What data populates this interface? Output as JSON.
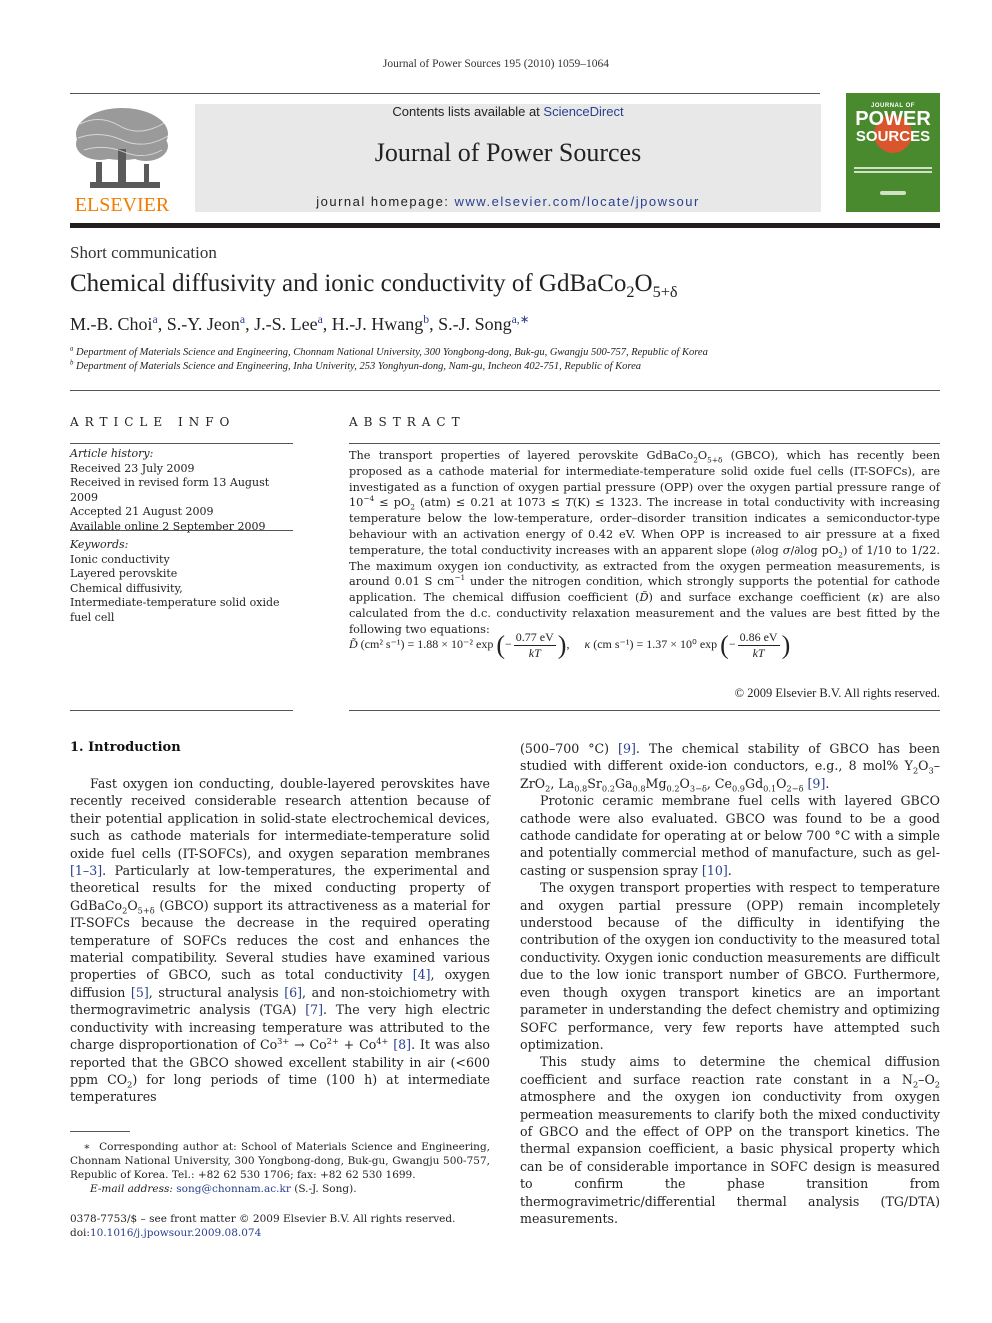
{
  "running_head": "Journal of Power Sources 195 (2010) 1059–1064",
  "header": {
    "contents_prefix": "Contents lists available at ",
    "contents_link": "ScienceDirect",
    "journal_title": "Journal of Power Sources",
    "homepage_prefix": "journal homepage: ",
    "homepage_link": "www.elsevier.com/locate/jpowsour",
    "publisher_logo": "ELSEVIER",
    "cover_title_top": "JOURNAL OF",
    "cover_title_main": "POWER",
    "cover_title_sub": "SOURCES",
    "colors": {
      "link": "#2a3f8f",
      "elsevier_orange": "#f07c00",
      "cover_green": "#4a8a2e",
      "cover_sun": "#d9552b"
    }
  },
  "article": {
    "type": "Short communication",
    "title_main": "Chemical diffusivity and ionic conductivity of GdBaCo",
    "title_sub2": "2",
    "title_o": "O",
    "title_sub_delta": "5+δ",
    "authors": [
      {
        "name": "M.-B. Choi",
        "affil": "a"
      },
      {
        "name": "S.-Y. Jeon",
        "affil": "a"
      },
      {
        "name": "J.-S. Lee",
        "affil": "a"
      },
      {
        "name": "H.-J. Hwang",
        "affil": "b"
      },
      {
        "name": "S.-J. Song",
        "affil": "a,∗"
      }
    ],
    "affiliations": [
      {
        "mark": "a",
        "text": "Department of Materials Science and Engineering, Chonnam National University, 300 Yongbong-dong, Buk-gu, Gwangju 500-757, Republic of Korea"
      },
      {
        "mark": "b",
        "text": "Department of Materials Science and Engineering, Inha Univerity, 253 Yonghyun-dong, Nam-gu, Incheon 402-751, Republic of Korea"
      }
    ]
  },
  "article_info": {
    "label": "ARTICLE INFO",
    "history_label": "Article history:",
    "history": [
      "Received 23 July 2009",
      "Received in revised form 13 August 2009",
      "Accepted 21 August 2009",
      "Available online 2 September 2009"
    ],
    "keywords_label": "Keywords:",
    "keywords": [
      "Ionic conductivity",
      "Layered perovskite",
      "Chemical diffusivity,",
      "Intermediate-temperature solid oxide fuel cell"
    ]
  },
  "abstract": {
    "label": "ABSTRACT",
    "segments": [
      {
        "t": "The transport properties of layered perovskite GdBaCo"
      },
      {
        "sub": "2"
      },
      {
        "t": "O"
      },
      {
        "sub": "5+δ"
      },
      {
        "t": " (GBCO), which has recently been proposed as a cathode material for intermediate-temperature solid oxide fuel cells (IT-SOFCs), are investigated as a function of oxygen partial pressure (OPP) over the oxygen partial pressure range of 10"
      },
      {
        "sup": "−4"
      },
      {
        "t": " ≤ pO"
      },
      {
        "sub": "2"
      },
      {
        "t": " (atm) ≤ 0.21 at 1073 ≤ "
      },
      {
        "i": "T"
      },
      {
        "t": "(K) ≤ 1323. The increase in total conductivity with increasing temperature below the low-temperature, order–disorder transition indicates a semiconductor-type behaviour with an activation energy of 0.42 eV. When OPP is increased to air pressure at a fixed temperature, the total conductivity increases with an apparent slope (∂log "
      },
      {
        "i": "σ"
      },
      {
        "t": "/∂log pO"
      },
      {
        "sub": "2"
      },
      {
        "t": ") of 1/10 to 1/22. The maximum oxygen ion conductivity, as extracted from the oxygen permeation measurements, is around 0.01 S cm"
      },
      {
        "sup": "−1"
      },
      {
        "t": " under the nitrogen condition, which strongly supports the potential for cathode application. The chemical diffusion coefficient ("
      },
      {
        "i": "D̃"
      },
      {
        "t": ") and surface exchange coefficient ("
      },
      {
        "i": "κ"
      },
      {
        "t": ") are also calculated from the d.c. conductivity relaxation measurement and the values are best fitted by the following two equations:"
      }
    ],
    "equation": {
      "d_symbol": "D̃",
      "d_units": "(cm² s⁻¹) = 1.88 × 10⁻² exp",
      "d_num": "0.77 eV",
      "d_den": "kT",
      "k_symbol": "κ",
      "k_units": "(cm s⁻¹) = 1.37 × 10⁰ exp",
      "k_num": "0.86 eV",
      "k_den": "kT"
    },
    "copyright": "© 2009 Elsevier B.V. All rights reserved."
  },
  "introduction": {
    "heading": "1.  Introduction",
    "left_column": [
      {
        "indent": true,
        "segments": [
          {
            "t": "Fast oxygen ion conducting, double-layered perovskites have recently received considerable research attention because of their potential application in solid-state electrochemical devices, such as cathode materials for intermediate-temperature solid oxide fuel cells (IT-SOFCs), and oxygen separation membranes "
          },
          {
            "ref": "[1–3]"
          },
          {
            "t": ". Particularly at low-temperatures, the experimental and theoretical results for the mixed conducting property of GdBaCo"
          },
          {
            "sub": "2"
          },
          {
            "t": "O"
          },
          {
            "sub": "5+δ"
          },
          {
            "t": " (GBCO) support its attractiveness as a material for IT-SOFCs because the decrease in the required operating temperature of SOFCs reduces the cost and enhances the material compatibility. Several studies have examined various properties of GBCO, such as total conductivity "
          },
          {
            "ref": "[4]"
          },
          {
            "t": ", oxygen diffusion "
          },
          {
            "ref": "[5]"
          },
          {
            "t": ", structural analysis "
          },
          {
            "ref": "[6]"
          },
          {
            "t": ", and non-stoichiometry with thermogravimetric analysis (TGA) "
          },
          {
            "ref": "[7]"
          },
          {
            "t": ". The very high electric conductivity with increasing temperature was attributed to the charge disproportionation of Co"
          },
          {
            "sup": "3+"
          },
          {
            "t": " → Co"
          },
          {
            "sup": "2+"
          },
          {
            "t": " + Co"
          },
          {
            "sup": "4+"
          },
          {
            "t": " "
          },
          {
            "ref": "[8]"
          },
          {
            "t": ". It was also reported that the GBCO showed excellent stability in air (<600 ppm CO"
          },
          {
            "sub": "2"
          },
          {
            "t": ") for long periods of time (100 h) at intermediate temperatures"
          }
        ]
      }
    ],
    "right_column": [
      {
        "indent": false,
        "segments": [
          {
            "t": "(500–700 °C) "
          },
          {
            "ref": "[9]"
          },
          {
            "t": ". The chemical stability of GBCO has been studied with different oxide-ion conductors, e.g., 8 mol% Y"
          },
          {
            "sub": "2"
          },
          {
            "t": "O"
          },
          {
            "sub": "3"
          },
          {
            "t": "–ZrO"
          },
          {
            "sub": "2"
          },
          {
            "t": ", La"
          },
          {
            "sub": "0.8"
          },
          {
            "t": "Sr"
          },
          {
            "sub": "0.2"
          },
          {
            "t": "Ga"
          },
          {
            "sub": "0.8"
          },
          {
            "t": "Mg"
          },
          {
            "sub": "0.2"
          },
          {
            "t": "O"
          },
          {
            "sub": "3−δ"
          },
          {
            "t": ", Ce"
          },
          {
            "sub": "0.9"
          },
          {
            "t": "Gd"
          },
          {
            "sub": "0.1"
          },
          {
            "t": "O"
          },
          {
            "sub": "2−δ"
          },
          {
            "t": " "
          },
          {
            "ref": "[9]"
          },
          {
            "t": "."
          }
        ]
      },
      {
        "indent": true,
        "segments": [
          {
            "t": "Protonic ceramic membrane fuel cells with layered GBCO cathode were also evaluated. GBCO was found to be a good cathode candidate for operating at or below 700 °C with a simple and potentially commercial method of manufacture, such as gel-casting or suspension spray "
          },
          {
            "ref": "[10]"
          },
          {
            "t": "."
          }
        ]
      },
      {
        "indent": true,
        "segments": [
          {
            "t": "The oxygen transport properties with respect to temperature and oxygen partial pressure (OPP) remain incompletely understood because of the difficulty in identifying the contribution of the oxygen ion conductivity to the measured total conductivity. Oxygen ionic conduction measurements are difficult due to the low ionic transport number of GBCO. Furthermore, even though oxygen transport kinetics are an important parameter in understanding the defect chemistry and optimizing SOFC performance, very few reports have attempted such optimization."
          }
        ]
      },
      {
        "indent": true,
        "segments": [
          {
            "t": "This study aims to determine the chemical diffusion coefficient and surface reaction rate constant in a N"
          },
          {
            "sub": "2"
          },
          {
            "t": "–O"
          },
          {
            "sub": "2"
          },
          {
            "t": " atmosphere and the oxygen ion conductivity from oxygen permeation measurements to clarify both the mixed conductivity of GBCO and the effect of OPP on the transport kinetics. The thermal expansion coefficient, a basic physical property which can be of considerable importance in SOFC design is measured to confirm the phase transition from thermogravimetric/differential thermal analysis (TG/DTA) measurements."
          }
        ]
      }
    ]
  },
  "footnotes": {
    "corresponding_mark": "∗",
    "corresponding": "Corresponding author at: School of Materials Science and Engineering, Chonnam National University, 300 Yongbong-dong, Buk-gu, Gwangju 500-757, Republic of Korea. Tel.: +82 62 530 1706; fax: +82 62 530 1699.",
    "email_label": "E-mail address:",
    "email": "song@chonnam.ac.kr",
    "email_suffix": " (S.-J. Song).",
    "front_matter": "0378-7753/$ – see front matter © 2009 Elsevier B.V. All rights reserved.",
    "doi_prefix": "doi:",
    "doi": "10.1016/j.jpowsour.2009.08.074"
  }
}
